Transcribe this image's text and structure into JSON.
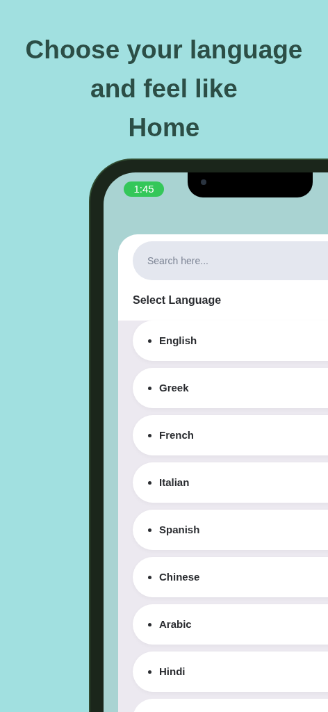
{
  "headline": [
    "Choose your language",
    "and feel like",
    "Home"
  ],
  "status_bar": {
    "time": "1:45"
  },
  "search": {
    "placeholder": "Search here..."
  },
  "section_title": "Select Language",
  "languages": [
    {
      "label": "English"
    },
    {
      "label": "Greek"
    },
    {
      "label": "French"
    },
    {
      "label": "Italian"
    },
    {
      "label": "Spanish"
    },
    {
      "label": "Chinese"
    },
    {
      "label": "Arabic"
    },
    {
      "label": "Hindi"
    }
  ]
}
